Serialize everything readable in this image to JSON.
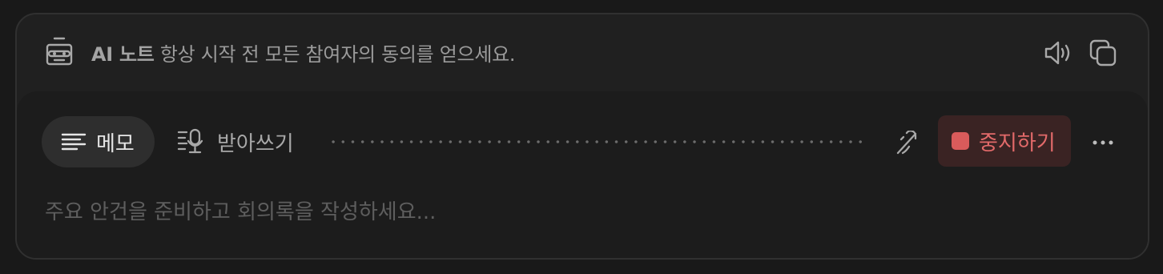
{
  "banner": {
    "brand": "AI 노트",
    "message": "항상 시작 전 모든 참여자의 동의를 얻으세요.",
    "icon": "robot-icon"
  },
  "toolbar": {
    "speaker_icon": "speaker-icon",
    "copy_icon": "copy-icon"
  },
  "tabs": [
    {
      "label": "메모",
      "icon": "lines-icon",
      "active": true
    },
    {
      "label": "받아쓰기",
      "icon": "transcript-mic-icon",
      "active": false
    }
  ],
  "controls": {
    "mic_icon": "mic-off-icon",
    "stop_label": "중지하기",
    "more_icon": "more-icon"
  },
  "memo": {
    "value": "",
    "placeholder": "주요 안건을 준비하고 회의록을 작성하세요..."
  },
  "colors": {
    "background": "#191919",
    "card": "#202020",
    "panel": "#1c1c1c",
    "stop_accent": "#e36a6a",
    "stop_bg": "#3a2323"
  }
}
